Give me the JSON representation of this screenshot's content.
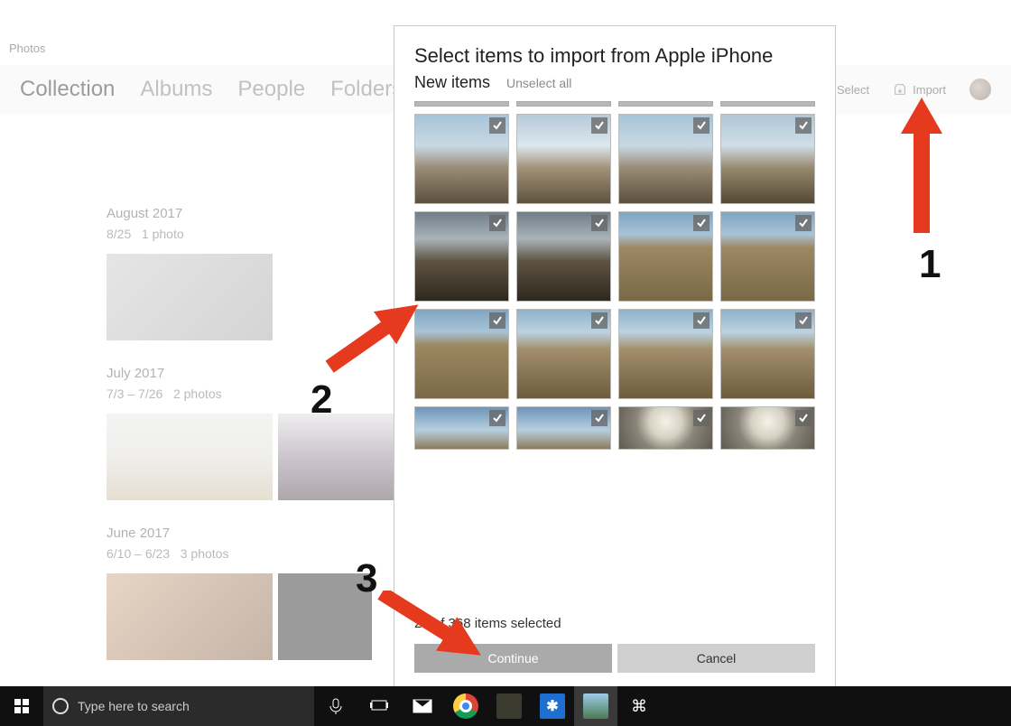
{
  "app_title": "Photos",
  "nav": {
    "tabs": [
      "Collection",
      "Albums",
      "People",
      "Folders"
    ],
    "active_index": 0
  },
  "actions": {
    "select_label": "Select",
    "import_label": "Import"
  },
  "collection": {
    "sections": [
      {
        "title": "August 2017",
        "sub_date": "8/25",
        "sub_count": "1 photo",
        "thumbs": [
          "hoodie"
        ]
      },
      {
        "title": "July 2017",
        "sub_date": "7/3 – 7/26",
        "sub_count": "2 photos",
        "thumbs": [
          "lighthouse",
          "girls"
        ]
      },
      {
        "title": "June 2017",
        "sub_date": "6/10 – 6/23",
        "sub_count": "3 photos",
        "thumbs": [
          "kids",
          "cat"
        ]
      }
    ]
  },
  "dialog": {
    "title": "Select items to import from Apple iPhone",
    "subtitle": "New items",
    "unselect_label": "Unselect all",
    "selection_summary": "23 of 368 items selected",
    "continue_label": "Continue",
    "cancel_label": "Cancel"
  },
  "annotations": {
    "labels": [
      "1",
      "2",
      "3"
    ]
  },
  "taskbar": {
    "search_placeholder": "Type here to search"
  }
}
